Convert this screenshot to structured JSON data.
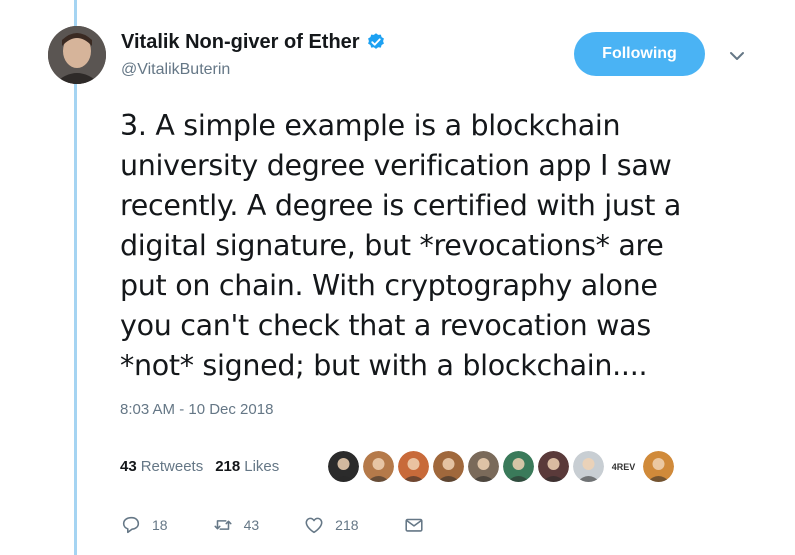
{
  "author": {
    "display_name": "Vitalik Non-giver of Ether",
    "handle": "@VitalikButerin",
    "verified_icon": "verified-badge-icon"
  },
  "follow_button": {
    "label": "Following"
  },
  "tweet": {
    "text": "3. A simple example is a blockchain\nuniversity degree verification app I saw\nrecently. A degree is certified with just a\ndigital signature, but *revocations* are\nput on chain. With cryptography alone\nyou can't check that a revocation was\n*not* signed; but with a blockchain....",
    "timestamp": "8:03 AM - 10 Dec 2018"
  },
  "stats": {
    "retweets_count": "43",
    "retweets_label": "Retweets",
    "likes_count": "218",
    "likes_label": "Likes"
  },
  "liker_faces": [
    {
      "name": "face-1",
      "color": "#2b2b2b",
      "text": ""
    },
    {
      "name": "face-2",
      "color": "#b57a4a",
      "text": ""
    },
    {
      "name": "face-3",
      "color": "#c86a3a",
      "text": ""
    },
    {
      "name": "face-4",
      "color": "#a0683c",
      "text": ""
    },
    {
      "name": "face-5",
      "color": "#7a6a5a",
      "text": ""
    },
    {
      "name": "face-6",
      "color": "#3a7a5a",
      "text": ""
    },
    {
      "name": "face-7",
      "color": "#5a3a3a",
      "text": ""
    },
    {
      "name": "face-8",
      "color": "#c8ced3",
      "text": ""
    },
    {
      "name": "face-9",
      "color": "#ffffff",
      "text": "4REV"
    },
    {
      "name": "face-10",
      "color": "#d08a3a",
      "text": ""
    }
  ],
  "actions": {
    "reply_count": "18",
    "retweet_count": "43",
    "like_count": "218"
  },
  "colors": {
    "accent": "#4ab3f4",
    "thread_line": "#a5d4f2",
    "muted": "#657786"
  }
}
